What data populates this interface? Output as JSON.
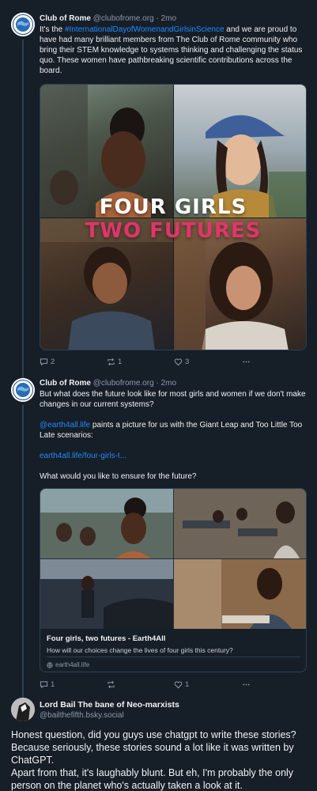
{
  "colors": {
    "background": "#161e27",
    "text": "#f1f3f5",
    "muted": "#8d9aab",
    "link": "#208bfe",
    "divider": "#2e4052",
    "overlay_line1": "#ffffff",
    "overlay_line2": "#e0356b"
  },
  "posts": [
    {
      "author": "Club of Rome",
      "handle": "@clubofrome.org",
      "separator": "·",
      "time": "2mo",
      "avatar_icon": "club-of-rome-logo",
      "text_before": "It's the ",
      "hashtag": "#InternationalDayofWomenandGirlsinScience",
      "text_after": " and we are proud to have had many brilliant members from The Club of Rome community who bring their STEM knowledge to systems thinking and challenging the status quo. These women have pathbreaking scientific contributions across the board.",
      "image_overlay": {
        "line1": "FOUR GIRLS",
        "line2": "TWO FUTURES"
      },
      "actions": {
        "replies": "2",
        "reposts": "1",
        "likes": "3",
        "more_icon": "ellipsis-icon"
      }
    },
    {
      "author": "Club of Rome",
      "handle": "@clubofrome.org",
      "separator": "·",
      "time": "2mo",
      "avatar_icon": "club-of-rome-logo",
      "para1": "But what does the future look like for most girls and women if we don't make changes in our current systems?",
      "para2_mention": "@earth4all.life",
      "para2_rest": " paints a picture for us with the Giant Leap and Too Little Too Late scenarios:",
      "para3_link": "earth4all.life/four-girls-t...",
      "para4": "What would you like to ensure for the future?",
      "card": {
        "title": "Four girls, two futures - Earth4All",
        "description": "How will our choices change the lives of four girls this century?",
        "domain": "earth4all.life",
        "domain_icon": "globe-icon"
      },
      "actions": {
        "replies": "1",
        "reposts": "",
        "likes": "1",
        "more_icon": "ellipsis-icon"
      }
    },
    {
      "author": "Lord Bail The bane of Neo-marxists",
      "handle": "@bailthefifth.bsky.social",
      "avatar_icon": "black-white-avatar",
      "text": "Honest question, did you guys use chatgpt to write these stories? Because seriously, these stories sound a lot like it was written by ChatGPT.\nApart from that, it's laughably blunt. But eh, I'm probably the only person on the planet who's actually taken a look at it."
    }
  ]
}
